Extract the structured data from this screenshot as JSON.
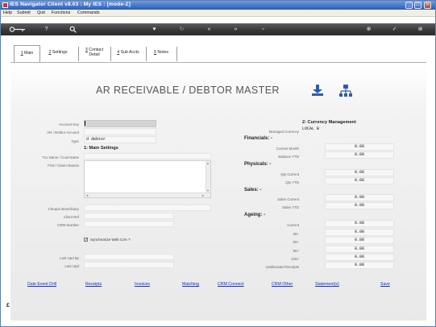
{
  "window": {
    "title": "IES Navigator Client v8.03 : My IES :     [mode-Z]",
    "controls": [
      "_",
      "□",
      "×"
    ]
  },
  "menu": [
    "Help",
    "Submit",
    "Quit",
    "Functions",
    "Commands"
  ],
  "toolbar": {
    "icons": [
      "key-icon",
      "help-icon",
      "search-icon",
      "heart-icon",
      "refresh-icon",
      "rewind-icon",
      "fast-forward-icon",
      "tree-icon",
      "plus-icon",
      "check-icon",
      "close-icon"
    ]
  },
  "tabs": [
    {
      "num": "1",
      "label": "Main",
      "active": true
    },
    {
      "num": "2",
      "label": "Settings"
    },
    {
      "num": "3",
      "label": "Contact",
      "label2": "Detail"
    },
    {
      "num": "4",
      "label": "Sub Accts"
    },
    {
      "num": "5",
      "label": "Notes"
    }
  ],
  "page": {
    "title": "AR RECEIVABLE / DEBTOR MASTER"
  },
  "left": {
    "account_key_label": "Account Key",
    "ar_account_label": "AR / Debtor Account",
    "type_label": "Type",
    "type_value": "d debtor",
    "main_settings": "1: Main Settings",
    "co_name_label": "*Co Name / Cust Name",
    "first_names_label": "First / Given Names",
    "cheque_label": "Cheque Beneficiary",
    "client_ref_label": "Client Ref",
    "crm_number_label": "CRM Number",
    "sync_label": "Synchronize With Crm ?",
    "sync_checked": "✓",
    "last_upd_by_label": "Last Upd By",
    "last_upd_label": "Last Upd"
  },
  "right": {
    "currency_title": "2: Currency Management",
    "managed_currency_label": "Managed Currency",
    "managed_currency_value": "LOCAL B",
    "financials": "Financials: -",
    "current_month_label": "Current Month",
    "current_month_value": "0.00",
    "balance_ytd_label": "Balance YTD",
    "balance_ytd_value": "0.00",
    "physicals": "Physicals: -",
    "qty_current_label": "Qty Current",
    "qty_current_value": "0.00",
    "qty_ytd_label": "Qty YTD",
    "qty_ytd_value": "0.00",
    "sales": "Sales: -",
    "sales_current_label": "Sales Current",
    "sales_current_value": "0.00",
    "sales_ytd_label": "Sales YTD",
    "sales_ytd_value": "0.00",
    "ageing": "Ageing: -",
    "ageing_current_label": "Current",
    "ageing_current_value": "0.00",
    "a30_label": "30+",
    "a30_value": "0.00",
    "a60_label": "60+",
    "a60_value": "0.00",
    "a90_label": "90+",
    "a90_value": "0.00",
    "a120_label": "120+",
    "a120_value": "0.00",
    "unallocated_label": "Unallocated Receipts",
    "unallocated_value": "0.00"
  },
  "links": [
    "Date Event Drill",
    "Receipts",
    "Invoices",
    "Matching",
    "CRM Connect",
    "CRM Other",
    "Statement(s)",
    "Save"
  ],
  "side_icon": "£"
}
